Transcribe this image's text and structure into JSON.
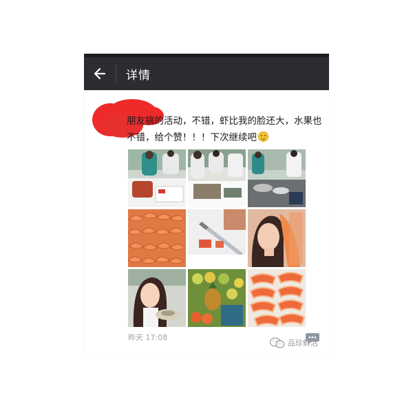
{
  "header": {
    "title": "详情",
    "back_icon": "arrow-left-icon"
  },
  "post": {
    "text": "朋友搞的活动，不错，虾比我的脸还大，水果也不错，给个赞！！！下次继续吧",
    "emoji": "smile-emoji",
    "timestamp": "昨天 17:08"
  },
  "photos": [
    {
      "subject": "chefs-carving-station"
    },
    {
      "subject": "chefs-cutting-fish"
    },
    {
      "subject": "cooking-station"
    },
    {
      "subject": "grilled-shrimp-platter"
    },
    {
      "subject": "knife-slicing-fish"
    },
    {
      "subject": "woman-holding-shrimp"
    },
    {
      "subject": "woman-eating-selfie"
    },
    {
      "subject": "fruit-display"
    },
    {
      "subject": "sliced-papaya"
    }
  ],
  "comment_icon": "comment-bubble-icon",
  "watermark": {
    "text": "品珍鲜活",
    "icon": "wechat-logo-icon"
  },
  "colors": {
    "header_bg": "#2b2d30",
    "redaction": "#ee2a2a",
    "timestamp": "#a2a2a2"
  }
}
